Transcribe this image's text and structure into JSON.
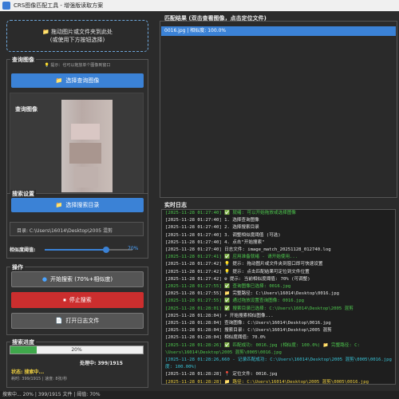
{
  "window": {
    "title": "CRS图像匹配工具 - 增强版读取方案"
  },
  "drop_zone": {
    "line1": "拖动图片或文件夹到此处",
    "line2": "(或使用下方按钮选择)"
  },
  "query": {
    "group_title": "查询图像",
    "hint": "提示：也可以拖放单个图像到窗口",
    "select_button": "选择查询图像",
    "preview_label": "查询图像"
  },
  "search": {
    "group_title": "搜索设置",
    "select_dir_button": "选择搜索目录",
    "dir_text": "目录: C:\\Users\\16014\\Desktop\\2005 混剪",
    "threshold_label": "相似度阈值:",
    "threshold_value": 0.7,
    "threshold_text": "70%"
  },
  "actions": {
    "group_title": "操作",
    "start_button": "开始搜索 (70%+相似度)",
    "stop_button": "停止搜索",
    "log_button": "打开日志文件"
  },
  "progress": {
    "group_title": "搜索进度",
    "value": 0.2,
    "text": "20%",
    "processing": "处理中: 399/1915",
    "status": "状态: 搜索中...",
    "status_time": "",
    "sub": "耗时: 399/1915 | 速度: 8张/秒"
  },
  "results": {
    "title": "匹配结果 (双击查看图像，点击定位文件)",
    "rows": [
      "0016.jpg | 相似度: 100.0%"
    ]
  },
  "log": {
    "title": "实时日志",
    "lines": [
      {
        "text": "[2025-11-28 01:27:40] ✅ 就绪: 可以开始拖放或选择图像",
        "color": "c-green"
      },
      {
        "text": "[2025-11-28 01:27:40] 1. 选择查询图像",
        "color": "c-white"
      },
      {
        "text": "[2025-11-28 01:27:40] 2. 选择搜索目录",
        "color": "c-white"
      },
      {
        "text": "[2025-11-28 01:27:40] 3. 调整相似度阈值 (可选)",
        "color": "c-white"
      },
      {
        "text": "[2025-11-28 01:27:40] 4. 点击\"开始搜索\"",
        "color": "c-white"
      },
      {
        "text": "[2025-11-28 01:27:40] 日志文件: image_match_20251128_012740.log",
        "color": "c-white"
      },
      {
        "text": "[2025-11-28 01:27:41] ✅ 应用准备就绪 - 请开始使用...",
        "color": "c-green"
      },
      {
        "text": "[2025-11-28 01:27:42] 💡 提示: 拖动图片或文件夹到窗口即可快速设置",
        "color": "c-white"
      },
      {
        "text": "[2025-11-28 01:27:42] 💡 提示: 点击匹配结果可定位到文件位置",
        "color": "c-white"
      },
      {
        "text": "[2025-11-28 01:27:42] ⚙ 提示: 当前相似度阈值: 70% (可调整)",
        "color": "c-white"
      },
      {
        "text": "[2025-11-28 01:27:55] ✅ 查询图像已选择: 0016.jpg",
        "color": "c-green"
      },
      {
        "text": "[2025-11-28 01:27:55] 📁 完整路径: C:\\Users\\16014\\Desktop\\0016.jpg",
        "color": "c-white"
      },
      {
        "text": "[2025-11-28 01:27:55] ✅ 通过拖放设置查询图像: 0016.jpg",
        "color": "c-green"
      },
      {
        "text": "[2025-11-28 01:28:01] ✅ 搜索目录已选择: C:\\Users\\16014\\Desktop\\2005 混剪",
        "color": "c-green"
      },
      {
        "text": "[2025-11-28 01:28:04] ⚡ 开始搜索相似图像...",
        "color": "c-white"
      },
      {
        "text": "[2025-11-28 01:28:04] 查询图像: C:\\Users\\16014\\Desktop\\0016.jpg",
        "color": "c-white"
      },
      {
        "text": "[2025-11-28 01:28:04] 搜索目录: C:\\Users\\16014\\Desktop\\2005 混剪",
        "color": "c-white"
      },
      {
        "text": "[2025-11-28 01:28:04] 相似度阈值: 70.0%",
        "color": "c-white"
      },
      {
        "text": "[2025-11-28 01:28:26] ✅ 匹配成功: 0016.jpg (相似度: 100.0%) 📁 完整路径: C:",
        "color": "c-green"
      },
      {
        "text": "\\Users\\16014\\Desktop\\2005 混剪\\0005\\0016.jpg",
        "color": "c-green"
      },
      {
        "text": "[2025-11-28 01:28:26,660 - 记录匹配成功: C:\\Users\\16014\\Desktop\\2005 混剪\\0005\\0016.jpg (相似",
        "color": "c-cyan"
      },
      {
        "text": "度: 100.00%)",
        "color": "c-cyan"
      },
      {
        "text": "[2025-11-28 01:28:28] 📍 定位文件: 0016.jpg",
        "color": "c-white"
      },
      {
        "text": "[2025-11-28 01:28:28] 📁 路径: C:\\Users\\16014\\Desktop\\2005 混剪\\0005\\0016.jpg",
        "color": "c-yellow"
      }
    ]
  },
  "statusbar": {
    "text": "搜索中... 20% | 399/1915 文件 | 阈值: 70%"
  }
}
